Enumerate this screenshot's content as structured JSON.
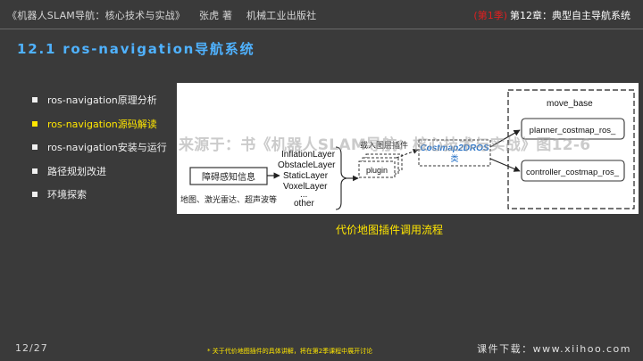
{
  "header": {
    "book_title": "《机器人SLAM导航：核心技术与实战》",
    "author": "张虎 著",
    "publisher": "机械工业出版社",
    "season": "(第1季)",
    "chapter": "第12章：典型自主导航系统"
  },
  "section_title": "12.1 ros-navigation导航系统",
  "menu": {
    "items": [
      {
        "label": "ros-navigation原理分析",
        "active": false
      },
      {
        "label": "ros-navigation源码解读",
        "active": true
      },
      {
        "label": "ros-navigation安装与运行",
        "active": false
      },
      {
        "label": "路径规划改进",
        "active": false
      },
      {
        "label": "环境探索",
        "active": false
      }
    ]
  },
  "diagram": {
    "obstacle_box": "障碍感知信息",
    "sensor_label": "地图、激光雷达、超声波等",
    "layers": [
      "InflationLayer",
      "ObstacleLayer",
      "StaticLayer",
      "VoxelLayer",
      "...",
      "other"
    ],
    "plugin": "plugin",
    "load_label": "载入图层插件",
    "costmap_name": "Costmap2DROS",
    "costmap_sub": "类",
    "move_base": "move_base",
    "planner": "planner_costmap_ros_",
    "controller": "controller_costmap_ros_"
  },
  "caption": "代价地图插件调用流程",
  "watermark": "来源于：书《机器人SLAM导航：核心技术与实战》图12-6",
  "footer": {
    "page": "12/27",
    "note": "* 关于代价地图插件的具体讲解，将在第2季课程中展开讨论",
    "download": "课件下载：www.xiihoo.com"
  },
  "colors": {
    "background": "#3a3a3a",
    "title_blue": "#4fb2ff",
    "highlight_yellow": "#ffe600",
    "season_red": "#e02020",
    "costmap_blue": "#2a74c8"
  }
}
